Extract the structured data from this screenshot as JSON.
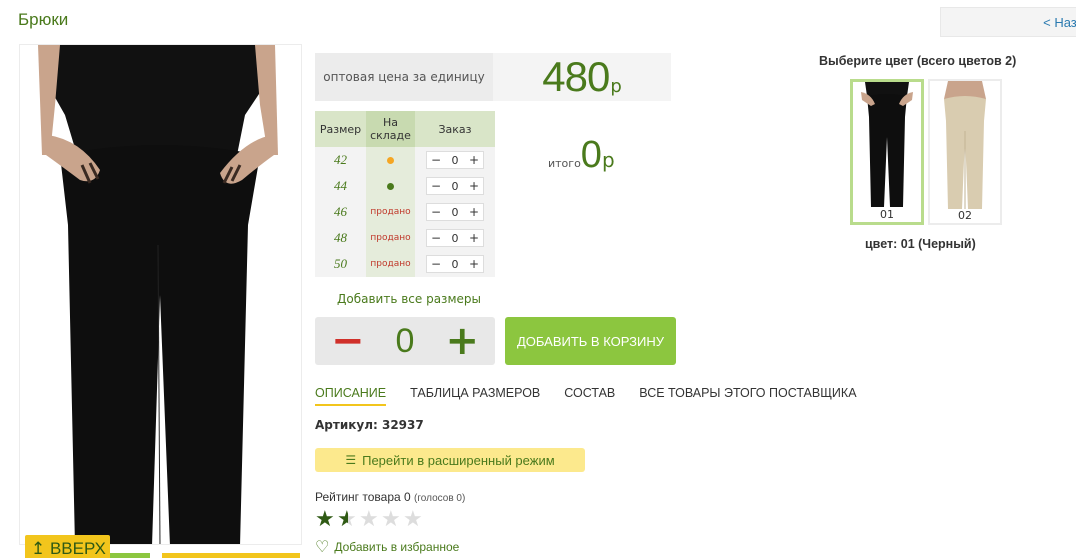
{
  "page": {
    "title": "Брюки",
    "back": "< Наза"
  },
  "price": {
    "label": "оптовая цена за единицу",
    "value": "480",
    "currency": "р"
  },
  "sizes": {
    "headers": {
      "size": "Размер",
      "stock": "На складе",
      "order": "Заказ"
    },
    "rows": [
      {
        "size": "42",
        "stock": "",
        "dot": "orange",
        "qty": "0"
      },
      {
        "size": "44",
        "stock": "",
        "dot": "green",
        "qty": "0"
      },
      {
        "size": "46",
        "stock": "продано",
        "dot": "",
        "qty": "0"
      },
      {
        "size": "48",
        "stock": "продано",
        "dot": "",
        "qty": "0"
      },
      {
        "size": "50",
        "stock": "продано",
        "dot": "",
        "qty": "0"
      }
    ]
  },
  "total": {
    "label": "итого",
    "value": "0",
    "currency": "р"
  },
  "add_all": "Добавить все размеры",
  "quantity": {
    "value": "0",
    "minus": "−",
    "plus": "+"
  },
  "cart_button": "ДОБАВИТЬ В КОРЗИНУ",
  "tabs": [
    {
      "label": "ОПИСАНИЕ"
    },
    {
      "label": "ТАБЛИЦА РАЗМЕРОВ"
    },
    {
      "label": "СОСТАВ"
    },
    {
      "label": "ВСЕ ТОВАРЫ ЭТОГО ПОСТАВЩИКА"
    }
  ],
  "article": "Артикул: 32937",
  "extended_mode": "Перейти в расширенный режим",
  "rating": {
    "label": "Рейтинг товара 0",
    "votes": "(голосов 0)",
    "stars": 1.5
  },
  "favorite": "Добавить в избранное",
  "up_button": "↥ ВВЕРХ",
  "colors": {
    "title": "Выберите цвет (всего цветов 2)",
    "items": [
      {
        "label": "01"
      },
      {
        "label": "02"
      }
    ],
    "current": "цвет: 01 (Черный)"
  },
  "theme": {
    "accent": "#4a7a1c",
    "button_green": "#8cc63f",
    "yellow": "#f2c51c",
    "danger": "#d0302a"
  }
}
